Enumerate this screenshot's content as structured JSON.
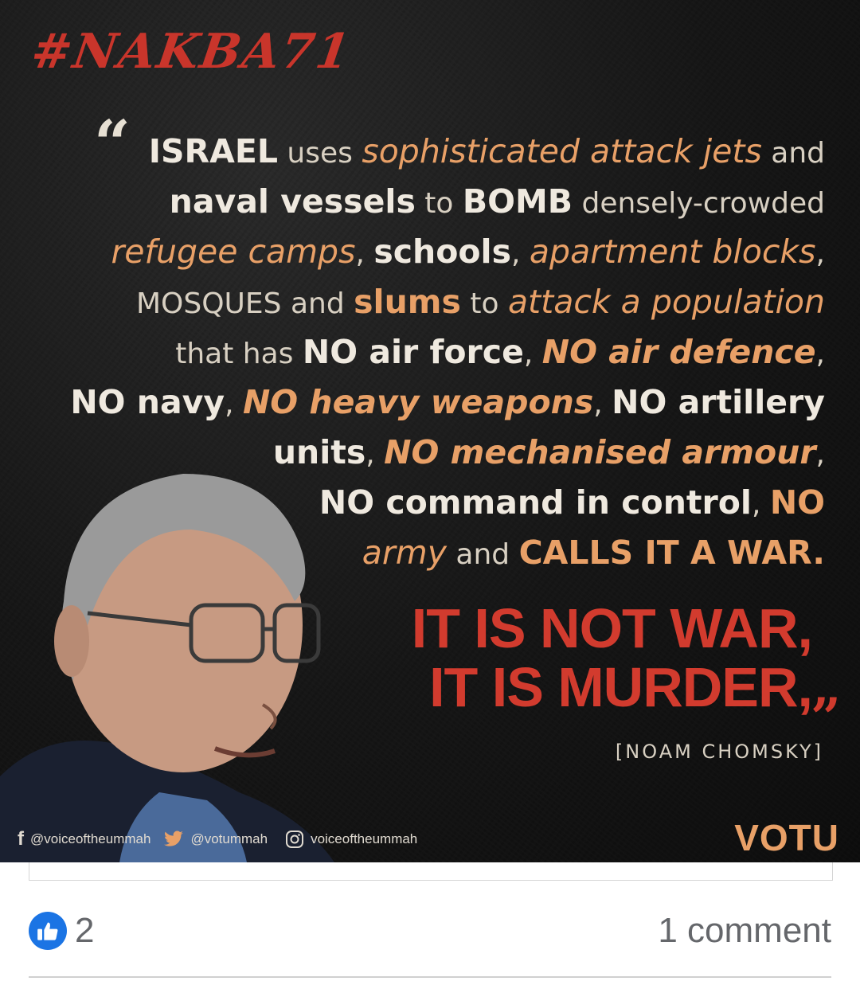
{
  "post": {
    "image": {
      "hashtag": "#NAKBA71",
      "quote_lines": [
        [
          [
            "lg",
            "ISRAEL"
          ],
          [
            "lt",
            " uses "
          ],
          [
            "or",
            "sophisticated attack jets"
          ],
          [
            "lt",
            " and"
          ]
        ],
        [
          [
            "lg",
            "naval vessels"
          ],
          [
            "lt",
            " to "
          ],
          [
            "lg",
            "BOMB"
          ],
          [
            "lt",
            " densely-crowded"
          ]
        ],
        [
          [
            "or",
            "refugee camps"
          ],
          [
            "lt",
            ", "
          ],
          [
            "lg",
            "schools"
          ],
          [
            "lt",
            ", "
          ],
          [
            "or",
            "apartment blocks"
          ],
          [
            "lt",
            ","
          ]
        ],
        [
          [
            "lt",
            "MOSQUES and "
          ],
          [
            "orb",
            "slums"
          ],
          [
            "lt",
            " to "
          ],
          [
            "or",
            "attack a population"
          ]
        ],
        [
          [
            "lt",
            "that has "
          ],
          [
            "lg",
            "NO air force"
          ],
          [
            "lt",
            ", "
          ],
          [
            "orbi",
            "NO air defence"
          ],
          [
            "lt",
            ","
          ]
        ],
        [
          [
            "lg",
            "NO navy"
          ],
          [
            "lt",
            ", "
          ],
          [
            "orbi",
            "NO heavy weapons"
          ],
          [
            "lt",
            ", "
          ],
          [
            "lg",
            "NO artillery"
          ]
        ],
        [
          [
            "lg",
            "units"
          ],
          [
            "lt",
            ", "
          ],
          [
            "orbi",
            "NO mechanised armour"
          ],
          [
            "lt",
            ","
          ]
        ],
        [
          [
            "lg",
            "NO command in control"
          ],
          [
            "lt",
            ", "
          ],
          [
            "orb",
            "NO"
          ]
        ],
        [
          [
            "or",
            "army"
          ],
          [
            "lt",
            " and "
          ],
          [
            "orb",
            "CALLS IT A WAR."
          ]
        ]
      ],
      "verdict_line1": "IT IS NOT WAR,",
      "verdict_line2": "IT IS MURDER,",
      "attribution": "[NOAM CHOMSKY]",
      "social_facebook": "@voiceoftheummah",
      "social_twitter": "@votummah",
      "social_instagram": "voiceoftheummah",
      "brand": "VOTU"
    },
    "reactions": {
      "like_count": "2"
    },
    "comments": {
      "label": "1 comment"
    },
    "colors": {
      "accent_red": "#d23b2e",
      "accent_orange": "#e8a067",
      "like_blue": "#1b74e4",
      "meta_gray": "#65676b"
    }
  }
}
